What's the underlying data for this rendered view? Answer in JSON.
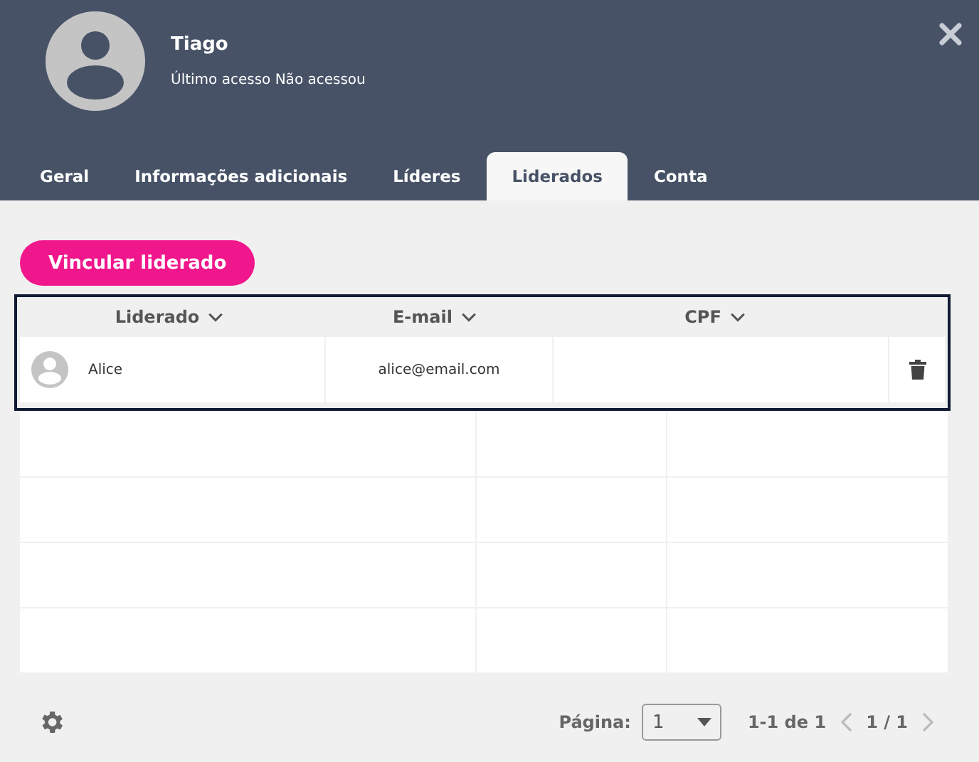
{
  "profile": {
    "name": "Tiago",
    "last_access_label": "Último acesso",
    "last_access_value": "Não acessou"
  },
  "tabs": [
    {
      "label": "Geral",
      "selected": false
    },
    {
      "label": "Informações adicionais",
      "selected": false
    },
    {
      "label": "Líderes",
      "selected": false
    },
    {
      "label": "Liderados",
      "selected": true
    },
    {
      "label": "Conta",
      "selected": false
    }
  ],
  "link_button": "Vincular liderado",
  "table": {
    "columns": [
      "Liderado",
      "E-mail",
      "CPF"
    ],
    "rows": [
      {
        "name": "Alice",
        "email": "alice@email.com"
      }
    ]
  },
  "pagination": {
    "label": "Página:",
    "page": "1",
    "range": "1-1 de 1",
    "pages": "1 / 1"
  }
}
